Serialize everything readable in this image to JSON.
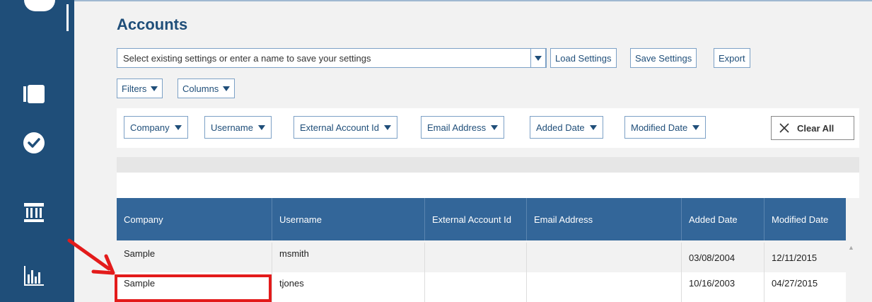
{
  "page": {
    "title": "Accounts"
  },
  "sidebar": {
    "items": [
      {
        "name": "documents-icon"
      },
      {
        "name": "checkmark-icon"
      },
      {
        "name": "bank-icon"
      },
      {
        "name": "bar-chart-icon"
      }
    ]
  },
  "settings": {
    "placeholder": "Select existing settings or enter a name to save your settings",
    "load_label": "Load Settings",
    "save_label": "Save Settings",
    "export_label": "Export"
  },
  "toolbar": {
    "filters_label": "Filters",
    "columns_label": "Columns"
  },
  "filter_chips": [
    "Company",
    "Username",
    "External Account Id",
    "Email Address",
    "Added Date",
    "Modified Date"
  ],
  "clear_all_label": "Clear All",
  "table": {
    "columns": [
      "Company",
      "Username",
      "External Account Id",
      "Email Address",
      "Added Date",
      "Modified Date"
    ],
    "rows": [
      {
        "company": "Sample",
        "username": "msmith",
        "external_id": "",
        "email": "",
        "added": "03/08/2004",
        "modified": "12/11/2015"
      },
      {
        "company": "Sample",
        "username": "tjones",
        "external_id": "",
        "email": "",
        "added": "10/16/2003",
        "modified": "04/27/2015"
      }
    ]
  },
  "colors": {
    "sidebar": "#1f4e79",
    "header": "#336699",
    "highlight": "#e31b1b"
  }
}
